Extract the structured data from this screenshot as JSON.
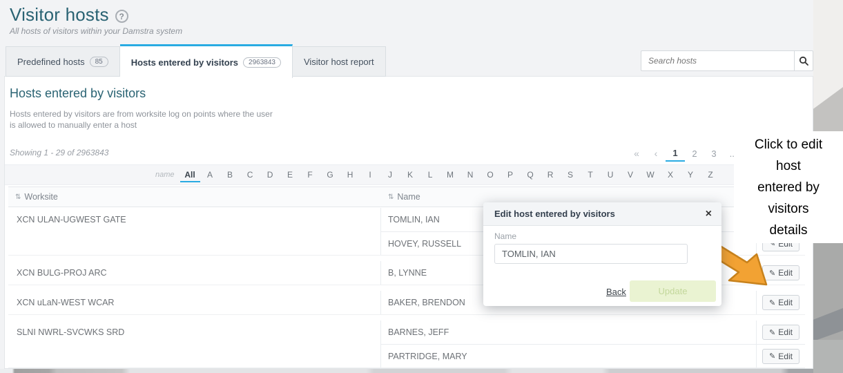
{
  "page": {
    "title": "Visitor hosts",
    "help_icon": "?",
    "subtitle": "All hosts of visitors within your Damstra system"
  },
  "tabs": [
    {
      "label": "Predefined hosts",
      "count": "85"
    },
    {
      "label": "Hosts entered by visitors",
      "count": "2963843"
    },
    {
      "label": "Visitor host report"
    }
  ],
  "search": {
    "placeholder": "Search hosts",
    "icon": "search"
  },
  "section": {
    "heading": "Hosts entered by visitors",
    "description_line1": "Hosts entered by visitors are from worksite log on points where the user",
    "description_line2": "is allowed to manually enter a host",
    "showing": "Showing 1 - 29 of 2963843"
  },
  "pagination": {
    "first": "«",
    "prev": "‹",
    "pages": [
      "1",
      "2",
      "3"
    ],
    "ellipsis": "...",
    "active_page": "1"
  },
  "alpha_filter": {
    "label": "name",
    "selected": "All",
    "letters": [
      "All",
      "A",
      "B",
      "C",
      "D",
      "E",
      "F",
      "G",
      "H",
      "I",
      "J",
      "K",
      "L",
      "M",
      "N",
      "O",
      "P",
      "Q",
      "R",
      "S",
      "T",
      "U",
      "V",
      "W",
      "X",
      "Y",
      "Z"
    ]
  },
  "table": {
    "sort_icon": "⇅",
    "columns": {
      "worksite": "Worksite",
      "name": "Name"
    },
    "groups": [
      {
        "worksite": "XCN ULAN-UGWEST GATE",
        "names": [
          "TOMLIN, IAN",
          "HOVEY, RUSSELL"
        ]
      },
      {
        "worksite": "XCN BULG-PROJ ARC",
        "names": [
          "B, LYNNE"
        ]
      },
      {
        "worksite": "XCN uLaN-WEST WCAR",
        "names": [
          "BAKER, BRENDON"
        ]
      },
      {
        "worksite": "SLNI NWRL-SVCWKS SRD",
        "names": [
          "BARNES, JEFF",
          "PARTRIDGE, MARY"
        ]
      }
    ],
    "edit_button": {
      "icon": "✎",
      "label": "Edit"
    }
  },
  "modal": {
    "title": "Edit host entered by visitors",
    "close_icon": "×",
    "name_label": "Name",
    "name_value": "TOMLIN, IAN",
    "back_label": "Back",
    "update_label": "Update"
  },
  "callout": {
    "text": "Click to edit host entered by visitors details",
    "lines": [
      "Click to edit",
      "host",
      "entered by",
      "visitors",
      "details"
    ]
  },
  "colors": {
    "accent_blue": "#29abe2",
    "heading_teal": "#2a6373",
    "arrow_orange_fill": "#f2a233",
    "arrow_orange_stroke": "#c8821c",
    "update_button_bg": "#eaf3d2",
    "update_button_text": "#c3d79b"
  }
}
